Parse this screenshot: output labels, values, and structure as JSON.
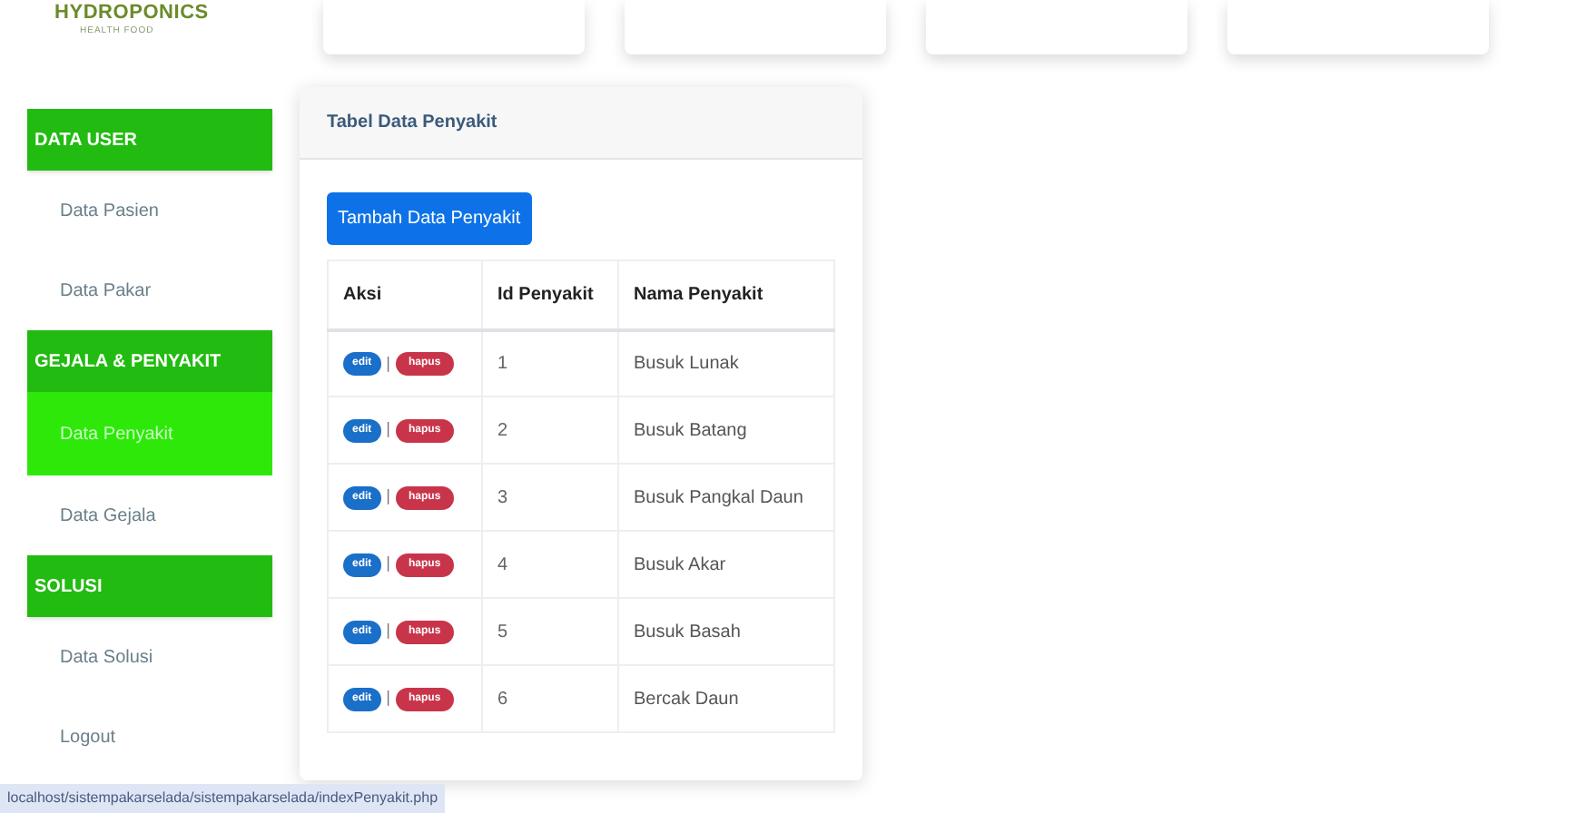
{
  "logo": {
    "title": "HYDROPONICS",
    "subtitle": "HEALTH FOOD"
  },
  "sidebar": [
    {
      "kind": "header",
      "label": "DATA USER"
    },
    {
      "kind": "item",
      "label": "Data Pasien",
      "selected": false
    },
    {
      "kind": "item",
      "label": "Data Pakar",
      "selected": false
    },
    {
      "kind": "header",
      "label": "GEJALA & PENYAKIT"
    },
    {
      "kind": "item",
      "label": "Data Penyakit",
      "selected": true
    },
    {
      "kind": "item",
      "label": "Data Gejala",
      "selected": false
    },
    {
      "kind": "header",
      "label": "SOLUSI"
    },
    {
      "kind": "item",
      "label": "Data Solusi",
      "selected": false
    },
    {
      "kind": "item",
      "label": "Logout",
      "selected": false
    }
  ],
  "card": {
    "title": "Tabel Data Penyakit",
    "add_button": "Tambah Data Penyakit"
  },
  "table": {
    "columns": [
      "Aksi",
      "Id Penyakit",
      "Nama Penyakit"
    ],
    "rows": [
      {
        "edit": "edit",
        "separator": "|",
        "delete": "hapus",
        "id": "1",
        "name": "Busuk Lunak"
      },
      {
        "edit": "edit",
        "separator": "|",
        "delete": "hapus",
        "id": "2",
        "name": "Busuk Batang"
      },
      {
        "edit": "edit",
        "separator": "|",
        "delete": "hapus",
        "id": "3",
        "name": "Busuk Pangkal Daun"
      },
      {
        "edit": "edit",
        "separator": "|",
        "delete": "hapus",
        "id": "4",
        "name": "Busuk Akar"
      },
      {
        "edit": "edit",
        "separator": "|",
        "delete": "hapus",
        "id": "5",
        "name": "Busuk Basah"
      },
      {
        "edit": "edit",
        "separator": "|",
        "delete": "hapus",
        "id": "6",
        "name": "Bercak Daun"
      }
    ]
  },
  "status_bar": "localhost/sistempakarselada/sistempakarselada/indexPenyakit.php"
}
